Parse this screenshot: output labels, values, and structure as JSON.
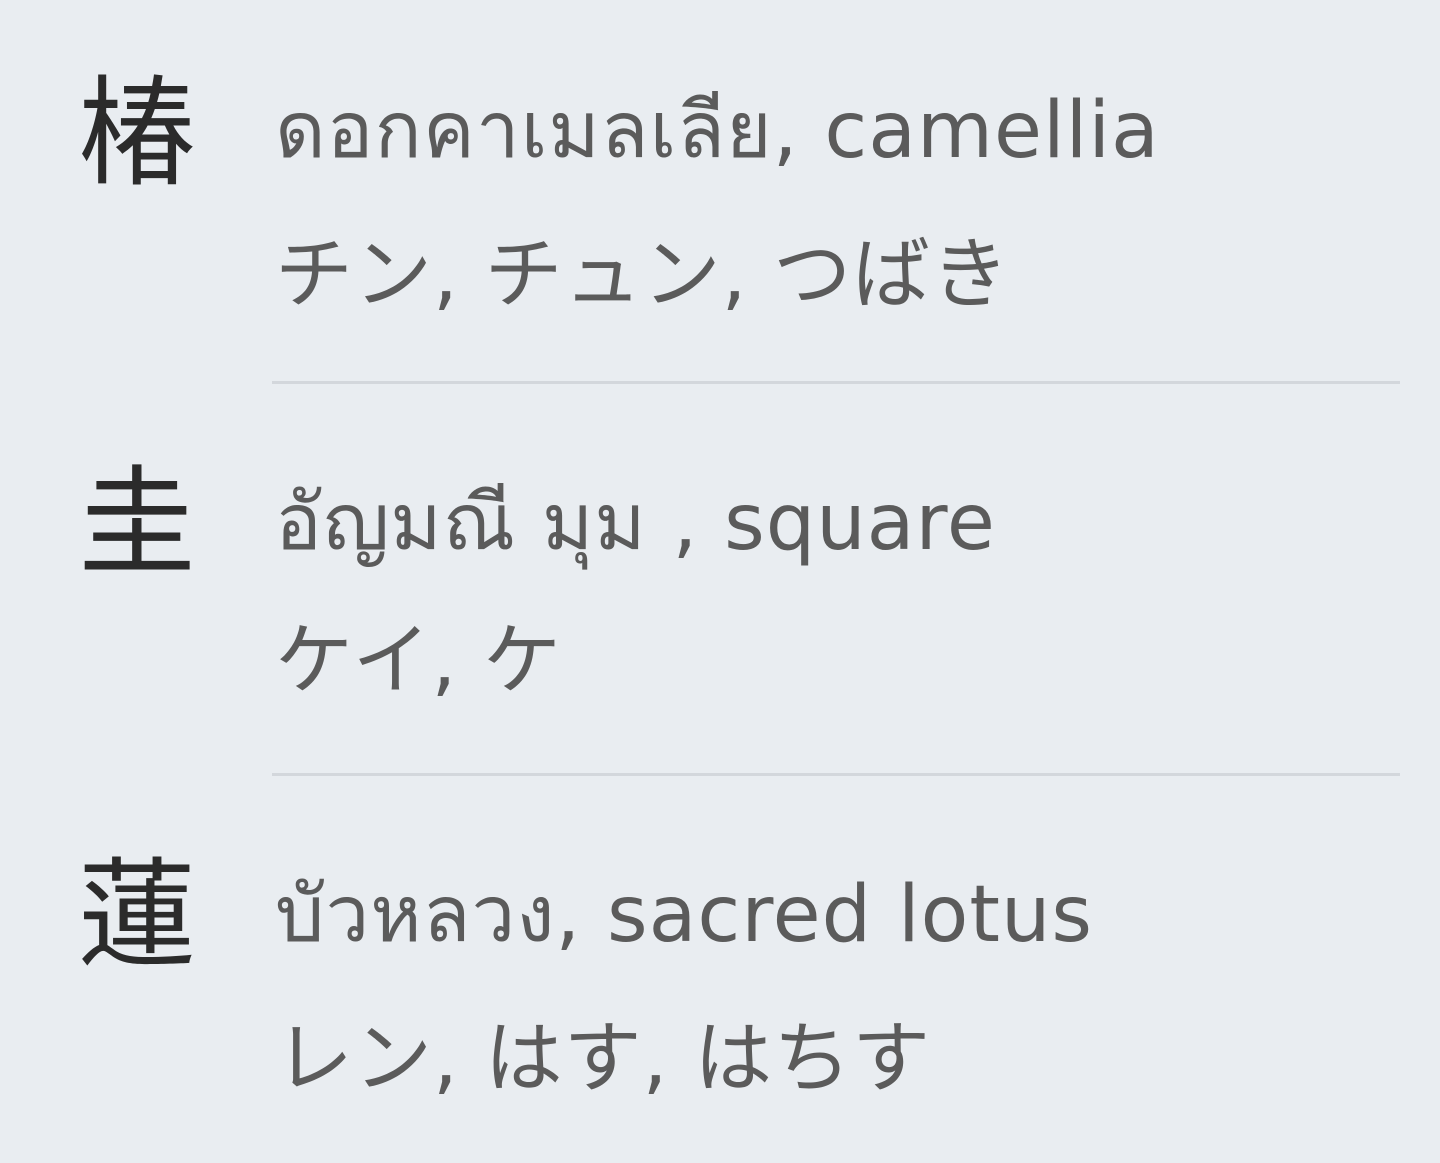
{
  "entries": [
    {
      "kanji": "椿",
      "meanings": "ดอกคาเมลเลีย, camellia",
      "readings": "チン, チュン, つばき"
    },
    {
      "kanji": "圭",
      "meanings": "อัญมณี มุม , square",
      "readings": "ケイ, ケ"
    },
    {
      "kanji": "蓮",
      "meanings": "บัวหลวง, sacred lotus",
      "readings": "レン, はす, はちす"
    }
  ]
}
